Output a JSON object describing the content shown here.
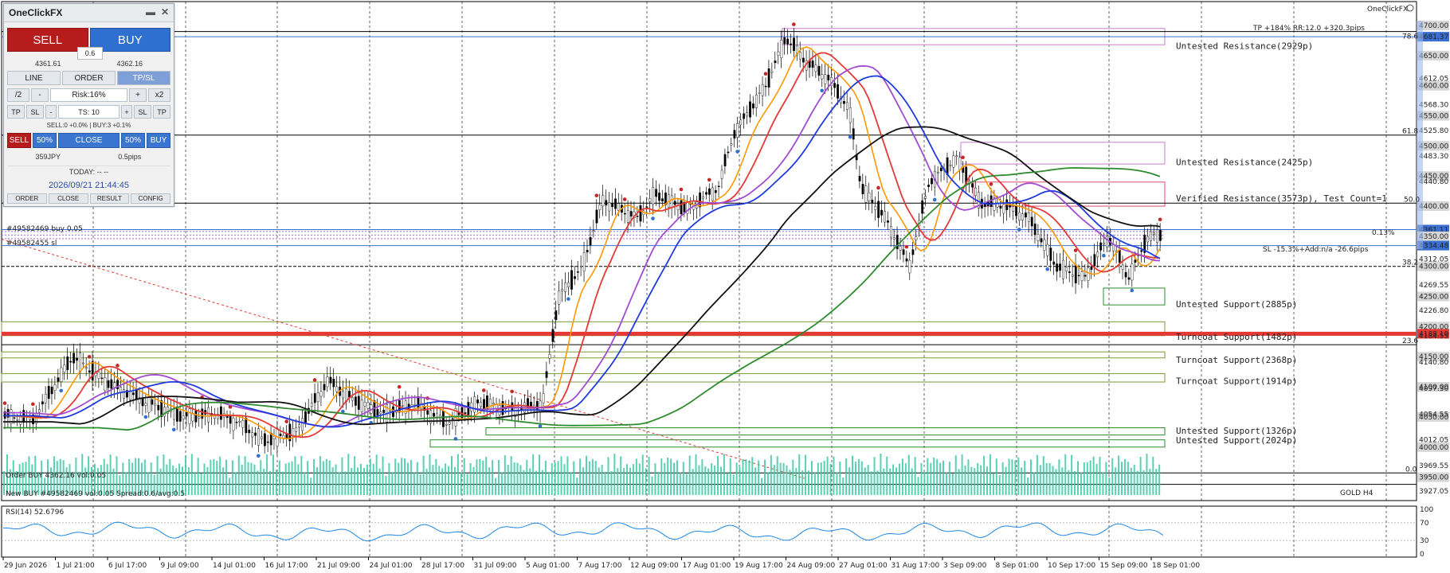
{
  "panel": {
    "title": "OneClickFX",
    "minimize_icon": "minimize-icon",
    "close_icon": "close-icon",
    "sell_label": "SELL",
    "buy_label": "BUY",
    "spread": "0.6",
    "sell_price": "4361.61",
    "buy_price": "4362.16",
    "tabs": [
      "LINE",
      "ORDER",
      "TP/SL"
    ],
    "lot_half": "/2",
    "lot_minus": "-",
    "risk": "Risk:16%",
    "lot_plus": "+",
    "lot_double": "x2",
    "tp": "TP",
    "sl": "SL",
    "ts_minus": "-",
    "ts": "TS: 10",
    "ts_plus": "+",
    "sl2": "SL",
    "tp2": "TP",
    "positions": "SELL:0 +0.0% | BUY:3 +0.1%",
    "close_sell": "SELL",
    "close_sell_pct": "50%",
    "close_all": "CLOSE",
    "close_buy_pct": "50%",
    "close_buy": "BUY",
    "profit": "359JPY",
    "pips": "0.5pips",
    "today": "TODAY: -- --",
    "datetime": "2026/09/21  21:44:45",
    "footer": [
      "ORDER",
      "CLOSE",
      "RESULT",
      "CONFIG"
    ]
  },
  "chart": {
    "brand": "OneClickFX",
    "symbol": "GOLD H4",
    "tp_text": "TP +184% RR:12.0 +320.3pips",
    "sl_text": "SL -15.3%+Add:n/a -26.6pips",
    "pct_text": "0.13%",
    "order_tag_1": "#49582469 buy 0.05",
    "order_tag_2": "#49582455 sl",
    "msg_1": "Order BUY 4362.16 vol:0.05",
    "msg_2": "New BUY #49582469 vol:0.05 Spread:0.6/avg:0.5",
    "rsi_label": "RSI(14) 52.6796",
    "fib_labels": [
      "61.8",
      "50.0",
      "38.2",
      "23.6",
      "0.0",
      "78.6"
    ],
    "zones": [
      "Untested Resistance(2929p)",
      "Untested Resistance(2425p)",
      "Verified Resistance(3573p), Test Count=1",
      "Untested Support(2885p)",
      "Turncoat Support(1482p)",
      "Turncoat Support(2368p)",
      "Turncoat Support(1914p)",
      "Untested Support(1326p)",
      "Untested Support(2024p)"
    ],
    "price_axis": [
      "4700.00",
      "4681.37",
      "4650.00",
      "4612.05",
      "4600.00",
      "4568.30",
      "4550.00",
      "4525.80",
      "4500.00",
      "4483.30",
      "4450.00",
      "4440.80",
      "4400.00",
      "4361.11",
      "4350.00",
      "4334.48",
      "4312.05",
      "4300.00",
      "4269.55",
      "4250.00",
      "4226.80",
      "4200.00",
      "4188.10",
      "4184.55",
      "4150.00",
      "4140.80",
      "4100.00",
      "4097.30",
      "4050.00",
      "4054.55",
      "4012.05",
      "4000.00",
      "3969.55",
      "3950.00",
      "3927.05"
    ],
    "rsi_axis": [
      "100",
      "70",
      "30",
      "0"
    ],
    "time_axis": [
      "29 Jun 2026",
      "1 Jul 21:00",
      "6 Jul 17:00",
      "9 Jul 09:00",
      "14 Jul 01:00",
      "16 Jul 17:00",
      "21 Jul 09:00",
      "24 Jul 01:00",
      "28 Jul 17:00",
      "31 Jul 09:00",
      "5 Aug 01:00",
      "7 Aug 17:00",
      "12 Aug 09:00",
      "17 Aug 01:00",
      "19 Aug 17:00",
      "24 Aug 09:00",
      "27 Aug 01:00",
      "31 Aug 17:00",
      "3 Sep 09:00",
      "8 Sep 01:00",
      "10 Sep 17:00",
      "15 Sep 09:00",
      "18 Sep 01:00"
    ],
    "colors": {
      "up": "#2f6fcf",
      "down": "#c62828",
      "ma_red": "#e53935",
      "ma_orange": "#ff9800",
      "ma_blue": "#1e3adf",
      "ma_purple": "#a04bd0",
      "ma_black": "#111111",
      "ma_green": "#2e8b2e"
    }
  }
}
